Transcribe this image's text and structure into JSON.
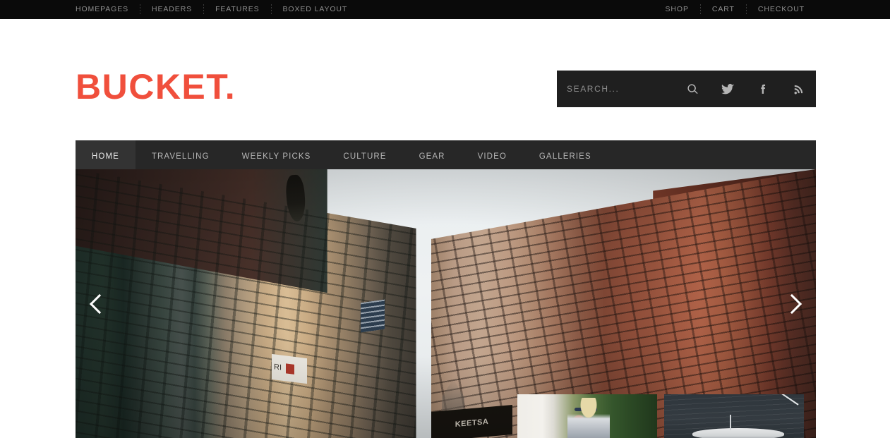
{
  "topbar": {
    "left_links": [
      "HOMEPAGES",
      "HEADERS",
      "FEATURES",
      "BOXED LAYOUT"
    ],
    "right_links": [
      "SHOP",
      "CART",
      "CHECKOUT"
    ]
  },
  "masthead": {
    "logo_text": "BUCKET",
    "logo_dot": ".",
    "logo_color": "#f04f3c"
  },
  "search": {
    "placeholder": "SEARCH...",
    "value": "",
    "icons": [
      "search-icon",
      "twitter-icon",
      "facebook-icon",
      "rss-icon"
    ]
  },
  "nav": {
    "items": [
      {
        "label": "HOME",
        "active": true
      },
      {
        "label": "TRAVELLING",
        "active": false
      },
      {
        "label": "WEEKLY PICKS",
        "active": false
      },
      {
        "label": "CULTURE",
        "active": false
      },
      {
        "label": "GEAR",
        "active": false
      },
      {
        "label": "VIDEO",
        "active": false
      },
      {
        "label": "GALLERIES",
        "active": false
      }
    ],
    "active_underline_color": "#f04f3c",
    "background": "#272727"
  },
  "hero": {
    "prev_label": "‹",
    "next_label": "›",
    "signs": {
      "keetsa": "KEETSA",
      "ri": "RI"
    },
    "thumbnails": [
      {
        "name": "thumbnail-woman-sunglasses"
      },
      {
        "name": "thumbnail-boat-water"
      }
    ]
  }
}
